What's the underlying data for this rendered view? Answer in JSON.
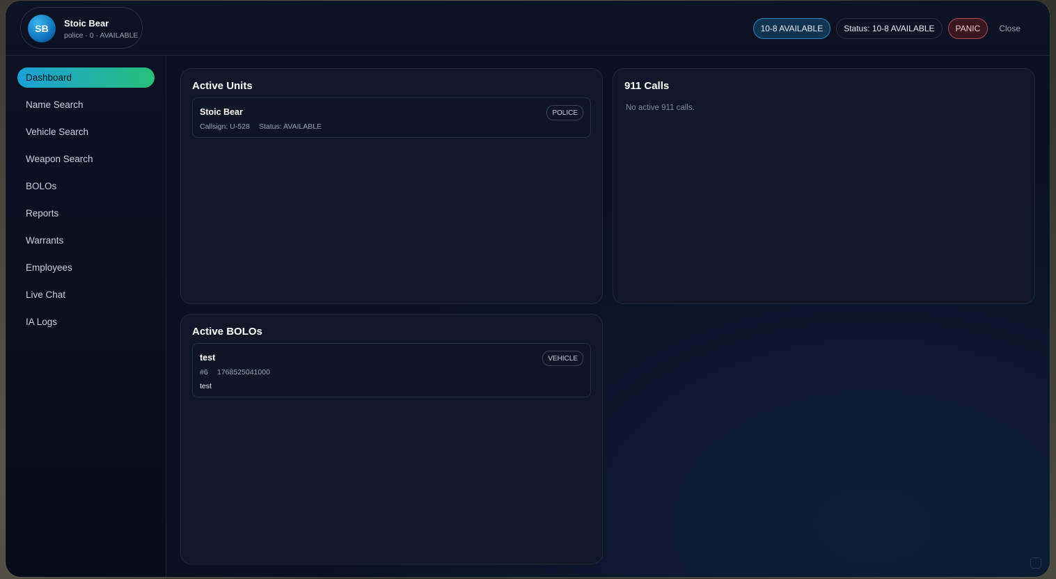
{
  "header": {
    "avatar_initials": "SB",
    "user_name": "Stoic Bear",
    "user_sub": "police · 0 · AVAILABLE",
    "available_label": "10-8 AVAILABLE",
    "status_label": "Status: 10-8 AVAILABLE",
    "panic_label": "PANIC",
    "close_label": "Close"
  },
  "sidebar": {
    "items": [
      {
        "label": "Dashboard"
      },
      {
        "label": "Name Search"
      },
      {
        "label": "Vehicle Search"
      },
      {
        "label": "Weapon Search"
      },
      {
        "label": "BOLOs"
      },
      {
        "label": "Reports"
      },
      {
        "label": "Warrants"
      },
      {
        "label": "Employees"
      },
      {
        "label": "Live Chat"
      },
      {
        "label": "IA Logs"
      }
    ]
  },
  "active_units": {
    "title": "Active Units",
    "units": [
      {
        "name": "Stoic Bear",
        "callsign": "Callsign: U-528",
        "status": "Status: AVAILABLE",
        "tag": "POLICE"
      }
    ]
  },
  "calls": {
    "title": "911 Calls",
    "empty": "No active 911 calls."
  },
  "bolos": {
    "title": "Active BOLOs",
    "items": [
      {
        "title": "test",
        "id": "#6",
        "timestamp": "1768525041000",
        "description": "test",
        "tag": "VEHICLE"
      }
    ]
  },
  "colors": {
    "accent_start": "#1aa0d8",
    "accent_end": "#27c07a",
    "panic": "#b24a5a",
    "background": "#0a1120"
  }
}
